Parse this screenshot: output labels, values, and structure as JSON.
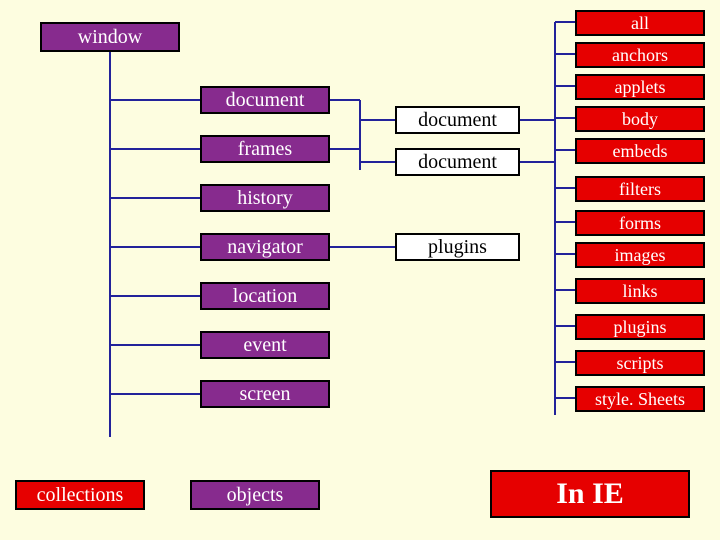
{
  "root": {
    "label": "window"
  },
  "col2": [
    {
      "label": "document"
    },
    {
      "label": "frames"
    },
    {
      "label": "history"
    },
    {
      "label": "navigator"
    },
    {
      "label": "location"
    },
    {
      "label": "event"
    },
    {
      "label": "screen"
    }
  ],
  "col3": [
    {
      "label": "document"
    },
    {
      "label": "document"
    },
    {
      "label": "plugins"
    }
  ],
  "col4": [
    {
      "label": "all"
    },
    {
      "label": "anchors"
    },
    {
      "label": "applets"
    },
    {
      "label": "body"
    },
    {
      "label": "embeds"
    },
    {
      "label": "filters"
    },
    {
      "label": "forms"
    },
    {
      "label": "images"
    },
    {
      "label": "links"
    },
    {
      "label": "plugins"
    },
    {
      "label": "scripts"
    },
    {
      "label": "style. Sheets"
    }
  ],
  "legend": {
    "collections": "collections",
    "objects": "objects",
    "in_ie": "In IE"
  }
}
